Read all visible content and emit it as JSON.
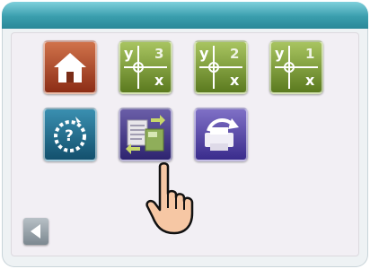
{
  "window": {
    "accent_color": "#3a9ead"
  },
  "tiles": [
    {
      "name": "home",
      "icon": "home-icon"
    },
    {
      "name": "graph-quadrant-3",
      "icon": "graph-icon",
      "y_label": "y",
      "x_label": "x",
      "quadrant": "3"
    },
    {
      "name": "graph-quadrant-2",
      "icon": "graph-icon",
      "y_label": "y",
      "x_label": "x",
      "quadrant": "2"
    },
    {
      "name": "graph-quadrant-1",
      "icon": "graph-icon",
      "y_label": "y",
      "x_label": "x",
      "quadrant": "1"
    },
    {
      "name": "help",
      "icon": "help-icon",
      "symbol": "?"
    },
    {
      "name": "file-transfer",
      "icon": "file-transfer-icon"
    },
    {
      "name": "print",
      "icon": "printer-refresh-icon"
    }
  ],
  "navigation": {
    "back_icon": "back-arrow-icon"
  },
  "cursor": {
    "icon": "pointing-hand-icon"
  }
}
